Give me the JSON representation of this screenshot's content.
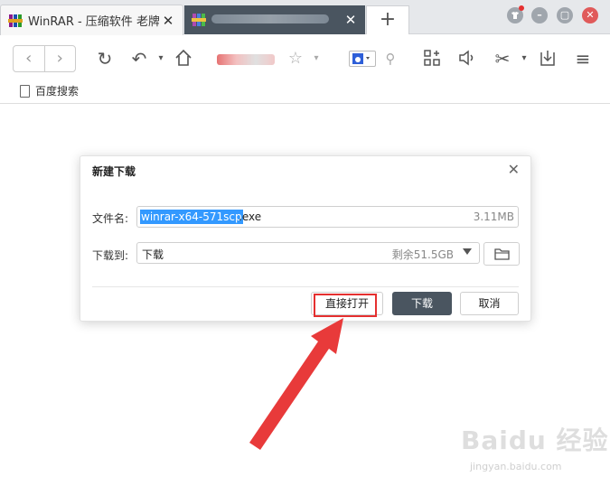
{
  "tabs": [
    {
      "title": "WinRAR - 压缩软件 老牌...",
      "close": "✕"
    },
    {
      "title": "",
      "close": "✕"
    }
  ],
  "new_tab_label": "+",
  "bookmarks": [
    {
      "label": "百度搜索"
    }
  ],
  "dialog": {
    "title": "新建下载",
    "filename_label": "文件名:",
    "filename_selected": "winrar-x64-571scp",
    "filename_ext": ".exe",
    "file_size": "3.11MB",
    "saveto_label": "下载到:",
    "saveto_value": "下载",
    "free_space": "剩余51.5GB",
    "btn_open": "直接打开",
    "btn_download": "下载",
    "btn_cancel": "取消"
  },
  "watermark": {
    "brand": "Baidu 经验",
    "url": "jingyan.baidu.com"
  },
  "colors": {
    "highlight": "#e53030",
    "selection": "#3399ff",
    "primary_button": "#4a5560"
  }
}
